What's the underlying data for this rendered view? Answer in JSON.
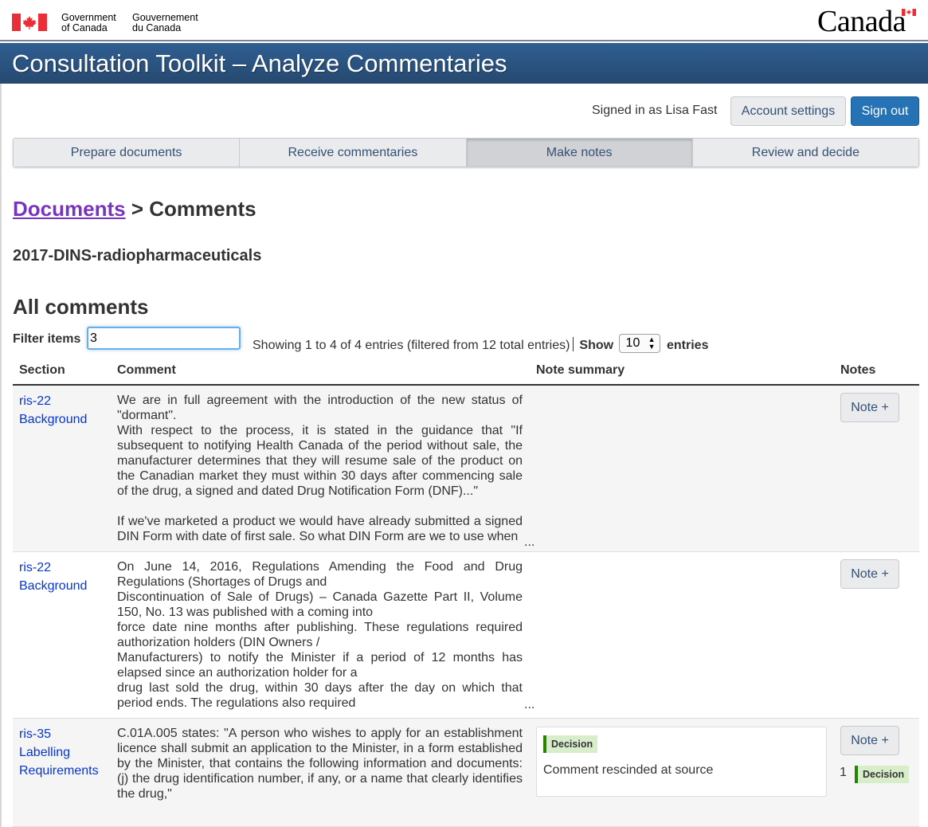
{
  "gov": {
    "en_line1": "Government",
    "en_line2": "of Canada",
    "fr_line1": "Gouvernement",
    "fr_line2": "du Canada",
    "wordmark": "Canada",
    "flag_red": "#eb2d37"
  },
  "app": {
    "title": "Consultation Toolkit – Analyze Commentaries"
  },
  "account": {
    "signed_in": "Signed in as Lisa Fast",
    "settings_label": "Account settings",
    "signout_label": "Sign out"
  },
  "steps": [
    {
      "label": "Prepare documents"
    },
    {
      "label": "Receive commentaries"
    },
    {
      "label": "Make notes",
      "active": true
    },
    {
      "label": "Review and decide"
    }
  ],
  "breadcrumb": {
    "link": "Documents",
    "separator": ">",
    "current": "Comments"
  },
  "document_title": "2017-DINS-radiopharmaceuticals",
  "section_heading": "All comments",
  "filter": {
    "label": "Filter items",
    "value": "3",
    "showing": "Showing 1 to 4 of 4 entries (filtered from 12 total entries)",
    "show_label": "Show",
    "page_length": "10",
    "entries_label": "entries"
  },
  "table": {
    "headers": {
      "section": "Section",
      "comment": "Comment",
      "note_summary": "Note summary",
      "notes": "Notes"
    },
    "rows": [
      {
        "section_line1": "ris-22",
        "section_line2": "Background",
        "comment_p1": "We are in full agreement with the introduction of the new status of \"dormant\".",
        "comment_p2": "With respect to the process, it is stated in the guidance that \"If subsequent to notifying Health Canada of the period without sale, the manufacturer determines that they will resume sale of the product on the Canadian market they must within 30 days after commencing sale of the drug, a signed and dated Drug Notification Form (DNF)...\"",
        "comment_p3": "If we've marketed a product we would have already submitted a signed DIN Form with date of first sale. So what DIN Form are we to use when",
        "ellipsis": "...",
        "note_button": "Note +"
      },
      {
        "section_line1": "ris-22",
        "section_line2": "Background",
        "comment_l1": "On June 14, 2016, Regulations Amending the Food and Drug Regulations (Shortages of Drugs and",
        "comment_l2": "Discontinuation of Sale of Drugs) – Canada Gazette Part II, Volume 150, No. 13 was published with a coming into",
        "comment_l3": "force date nine months after publishing. These regulations required authorization holders (DIN Owners /",
        "comment_l4": "Manufacturers) to notify the Minister if a period of 12 months has elapsed since an authorization holder for a",
        "comment_l5": "drug last sold the drug, within 30 days after the day on which that period ends. The regulations also required",
        "ellipsis": "...",
        "note_button": "Note +"
      },
      {
        "section_line1": "ris-35",
        "section_line2": "Labelling",
        "section_line3": "Requirements",
        "comment": "C.01A.005 states: \"A person who wishes to apply for an establishment licence shall submit an application to the Minister, in a form established by the Minister, that contains the following information and documents: (j) the drug identification number, if any, or a name that clearly identifies the drug,\"",
        "summary_tag": "Decision",
        "summary_text": "Comment rescinded at source",
        "note_button": "Note +",
        "note_count": "1",
        "note_tag": "Decision"
      }
    ]
  },
  "colors": {
    "app_bar": "#26496f",
    "link": "#0535d2",
    "visited_link": "#7834bc",
    "primary_button": "#2572b4",
    "decision_tag_bg": "#d8eeca",
    "decision_tag_border": "#278400"
  }
}
